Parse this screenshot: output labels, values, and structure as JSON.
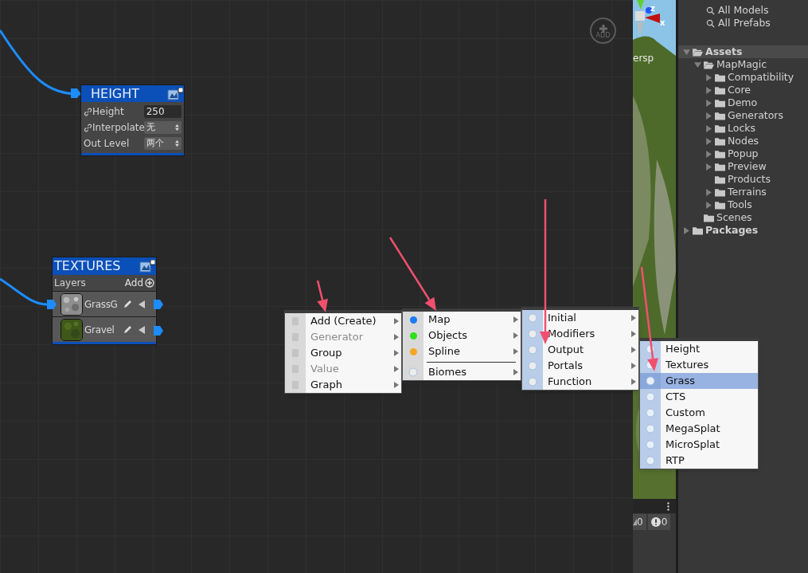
{
  "nodes": [
    {
      "title": "HEIGHT",
      "kind": "height",
      "fields": [
        {
          "label": "Height",
          "linked": true,
          "kind": "input",
          "value": "250"
        },
        {
          "label": "Interpolate",
          "linked": true,
          "kind": "dropdown",
          "value": "无"
        },
        {
          "label": "Out Level",
          "linked": false,
          "kind": "dropdown",
          "value": "两个"
        }
      ]
    },
    {
      "title": "TEXTURES",
      "kind": "textures",
      "section": "Layers",
      "action": "Add",
      "layers": [
        {
          "name": "GrassG",
          "kind": "stone"
        },
        {
          "name": "Gravel",
          "kind": "moss"
        }
      ]
    }
  ],
  "add_button": {
    "label": "ADD"
  },
  "menus": [
    {
      "items": [
        {
          "label": "Add (Create)",
          "kind": "icon",
          "disabled": false,
          "submenu": true,
          "selected": false
        },
        {
          "label": "Generator",
          "kind": "icon",
          "disabled": true,
          "submenu": true,
          "selected": false
        },
        {
          "label": "Group",
          "kind": "icon",
          "disabled": false,
          "submenu": true,
          "selected": false
        },
        {
          "label": "Value",
          "kind": "icon",
          "disabled": true,
          "submenu": true,
          "selected": false
        },
        {
          "label": "Graph",
          "kind": "icon",
          "disabled": false,
          "submenu": true,
          "selected": false
        }
      ]
    },
    {
      "items": [
        {
          "label": "Map",
          "kind": "dot",
          "color": "#1a7cf5",
          "disabled": false,
          "submenu": true,
          "selected": false
        },
        {
          "label": "Objects",
          "kind": "dot",
          "color": "#2ee01a",
          "disabled": false,
          "submenu": true,
          "selected": false
        },
        {
          "label": "Spline",
          "kind": "dot",
          "color": "#f5a623",
          "disabled": false,
          "submenu": true,
          "selected": false
        },
        {
          "kind": "separator"
        },
        {
          "label": "Biomes",
          "kind": "icon",
          "disabled": false,
          "submenu": true,
          "selected": false
        }
      ]
    },
    {
      "items": [
        {
          "label": "Initial",
          "kind": "icon",
          "disabled": false,
          "submenu": true,
          "selected": false
        },
        {
          "label": "Modifiers",
          "kind": "icon",
          "disabled": false,
          "submenu": true,
          "selected": false
        },
        {
          "label": "Output",
          "kind": "icon",
          "disabled": false,
          "submenu": true,
          "selected": false
        },
        {
          "label": "Portals",
          "kind": "icon",
          "disabled": false,
          "submenu": true,
          "selected": false
        },
        {
          "label": "Function",
          "kind": "icon",
          "disabled": false,
          "submenu": true,
          "selected": false
        }
      ]
    },
    {
      "items": [
        {
          "label": "Height",
          "kind": "icon",
          "disabled": false,
          "submenu": false,
          "selected": false
        },
        {
          "label": "Textures",
          "kind": "icon",
          "disabled": false,
          "submenu": false,
          "selected": false
        },
        {
          "label": "Grass",
          "kind": "icon",
          "disabled": false,
          "submenu": false,
          "selected": true
        },
        {
          "label": "CTS",
          "kind": "icon",
          "disabled": false,
          "submenu": false,
          "selected": false
        },
        {
          "label": "Custom",
          "kind": "icon",
          "disabled": false,
          "submenu": false,
          "selected": false
        },
        {
          "label": "MegaSplat",
          "kind": "icon",
          "disabled": false,
          "submenu": false,
          "selected": false
        },
        {
          "label": "MicroSplat",
          "kind": "icon",
          "disabled": false,
          "submenu": false,
          "selected": false
        },
        {
          "label": "RTP",
          "kind": "icon",
          "disabled": false,
          "submenu": false,
          "selected": false
        }
      ]
    }
  ],
  "scene": {
    "axes": [
      "z",
      "x"
    ],
    "view_label": "ersp"
  },
  "console": {
    "warnings": "0",
    "errors": "0"
  },
  "project": {
    "searches": [
      "All Models",
      "All Prefabs"
    ],
    "tree": [
      {
        "label": "Assets",
        "bold": true,
        "selected": true,
        "expandable": true,
        "expanded": true,
        "children": [
          {
            "label": "MapMagic",
            "bold": false,
            "selected": false,
            "expandable": true,
            "expanded": true,
            "children": [
              {
                "label": "Compatibility",
                "bold": false,
                "selected": false,
                "expandable": true,
                "expanded": false
              },
              {
                "label": "Core",
                "bold": false,
                "selected": false,
                "expandable": true,
                "expanded": false
              },
              {
                "label": "Demo",
                "bold": false,
                "selected": false,
                "expandable": true,
                "expanded": false
              },
              {
                "label": "Generators",
                "bold": false,
                "selected": false,
                "expandable": true,
                "expanded": false
              },
              {
                "label": "Locks",
                "bold": false,
                "selected": false,
                "expandable": true,
                "expanded": false
              },
              {
                "label": "Nodes",
                "bold": false,
                "selected": false,
                "expandable": true,
                "expanded": false
              },
              {
                "label": "Popup",
                "bold": false,
                "selected": false,
                "expandable": true,
                "expanded": false
              },
              {
                "label": "Preview",
                "bold": false,
                "selected": false,
                "expandable": true,
                "expanded": false
              },
              {
                "label": "Products",
                "bold": false,
                "selected": false,
                "expandable": false,
                "expanded": false
              },
              {
                "label": "Terrains",
                "bold": false,
                "selected": false,
                "expandable": true,
                "expanded": false
              },
              {
                "label": "Tools",
                "bold": false,
                "selected": false,
                "expandable": true,
                "expanded": false
              }
            ]
          },
          {
            "label": "Scenes",
            "bold": false,
            "selected": false,
            "expandable": false,
            "expanded": false
          }
        ]
      },
      {
        "label": "Packages",
        "bold": true,
        "selected": false,
        "expandable": true,
        "expanded": false
      }
    ]
  }
}
